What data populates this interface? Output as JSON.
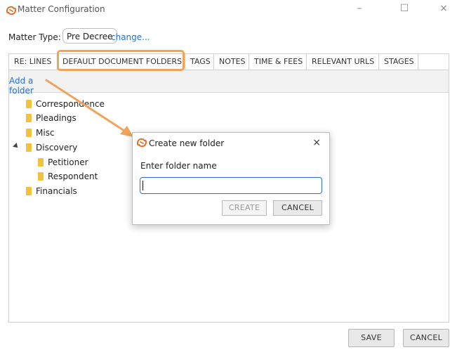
{
  "window": {
    "title": "Matter Configuration",
    "minimize": "–",
    "maximize": "☐",
    "close": "×"
  },
  "matter_type": {
    "label": "Matter Type:",
    "value": "Pre Decree",
    "change_link": "change..."
  },
  "tabs": [
    {
      "label": "RE: LINES"
    },
    {
      "label": "DEFAULT DOCUMENT FOLDERS"
    },
    {
      "label": "TAGS"
    },
    {
      "label": "NOTES"
    },
    {
      "label": "TIME & FEES"
    },
    {
      "label": "RELEVANT URLS"
    },
    {
      "label": "STAGES"
    }
  ],
  "add_folder": {
    "label": "Add a folder"
  },
  "tree": [
    {
      "label": "Correspondence"
    },
    {
      "label": "Pleadings"
    },
    {
      "label": "Misc"
    },
    {
      "label": "Discovery"
    },
    {
      "label": "Petitioner"
    },
    {
      "label": "Respondent"
    },
    {
      "label": "Financials"
    }
  ],
  "dialog": {
    "title": "Create new folder",
    "close": "×",
    "prompt": "Enter folder name",
    "input_value": "",
    "create_label": "CREATE",
    "cancel_label": "CANCEL"
  },
  "footer": {
    "save_label": "SAVE",
    "cancel_label": "CANCEL"
  },
  "colors": {
    "accent": "#2a6fcf",
    "highlight": "#f0a35a",
    "folder": "#f2c23d",
    "logo": "#e8702a"
  }
}
